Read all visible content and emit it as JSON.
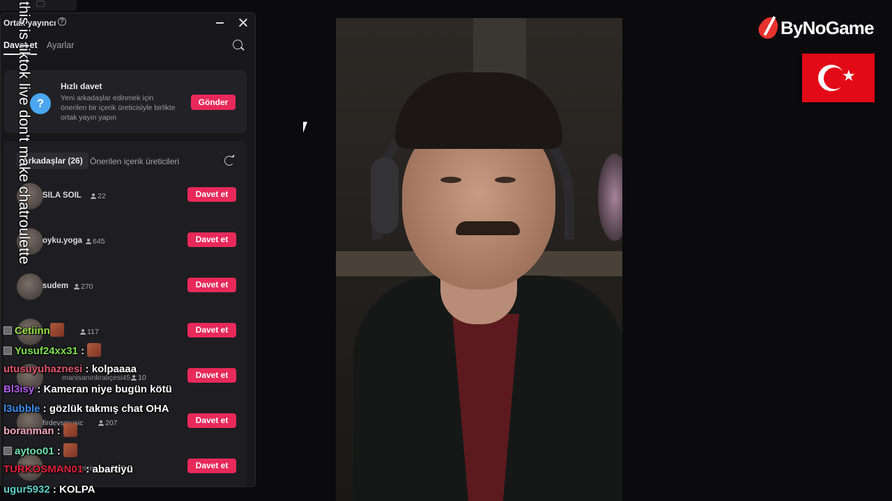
{
  "panel": {
    "title": "Ortak yayıncı",
    "tabs": {
      "invite": "Davet et",
      "settings": "Ayarlar"
    },
    "quick_invite": {
      "title": "Hızlı davet",
      "description": "Yeni arkadaşlar edinmek için önerilen bir içerik üreticisiyle birlikte ortak yayın yapın",
      "send_label": "Gönder"
    },
    "subtabs": {
      "friends": "Arkadaşlar (26)",
      "suggested": "Önerilen içerik üreticileri"
    },
    "friends": [
      {
        "name": "SILA SOIL",
        "count": "22",
        "invite": "Davet et"
      },
      {
        "name": "oyku.yoga",
        "count": "645",
        "invite": "Davet et"
      },
      {
        "name": "sudem",
        "count": "270",
        "invite": "Davet et"
      },
      {
        "name": "",
        "count": "117",
        "invite": "Davet et"
      },
      {
        "name": "manisanınkraliçesi45",
        "count": "10",
        "invite": "Davet et"
      },
      {
        "name": "firdevsmusic",
        "count": "207",
        "invite": "Davet et"
      },
      {
        "name": "mağilance.reisim",
        "count": "68",
        "invite": "Davet et"
      }
    ]
  },
  "vertical_caption": "this is tiktok live don't make chatroulette",
  "chat": [
    {
      "user": "Cetiinn",
      "message": "",
      "user_color": "#9be34a",
      "badge": true,
      "emote": true
    },
    {
      "user": "Yusuf24xx31",
      "message": "",
      "user_color": "#7ee04a",
      "badge": true,
      "emote": true
    },
    {
      "user": "utusuyuhaznesi",
      "message": "kolpaaaa",
      "user_color": "#e0556a",
      "badge": false,
      "emote": false
    },
    {
      "user": "Bl3isy",
      "message": "Kameran niye bugün kötü",
      "user_color": "#b35cf0",
      "badge": false,
      "emote": false
    },
    {
      "user": "l3ubble",
      "message": "gözlük takmış chat OHA",
      "user_color": "#3a8ef0",
      "badge": false,
      "emote": false
    },
    {
      "user": "boranman",
      "message": "",
      "user_color": "#f4a6c0",
      "badge": false,
      "emote": true
    },
    {
      "user": "aytoo01",
      "message": "",
      "user_color": "#6fe0b0",
      "badge": true,
      "emote": true
    },
    {
      "user": "TURKOSMAN01",
      "message": "abartiyü",
      "user_color": "#e0203a",
      "badge": false,
      "emote": false
    },
    {
      "user": "ugur5932",
      "message": "KOLPA",
      "user_color": "#5fd0c8",
      "badge": false,
      "emote": false
    }
  ],
  "brand": {
    "name": "ByNoGame"
  },
  "colors": {
    "accent": "#e8295a",
    "panel_bg": "#18181b",
    "flag_red": "#e30a17"
  },
  "icons": [
    "help-icon",
    "minimize-icon",
    "close-icon",
    "search-icon",
    "question-icon",
    "refresh-icon",
    "person-icon",
    "cursor-icon",
    "turkish-flag"
  ]
}
